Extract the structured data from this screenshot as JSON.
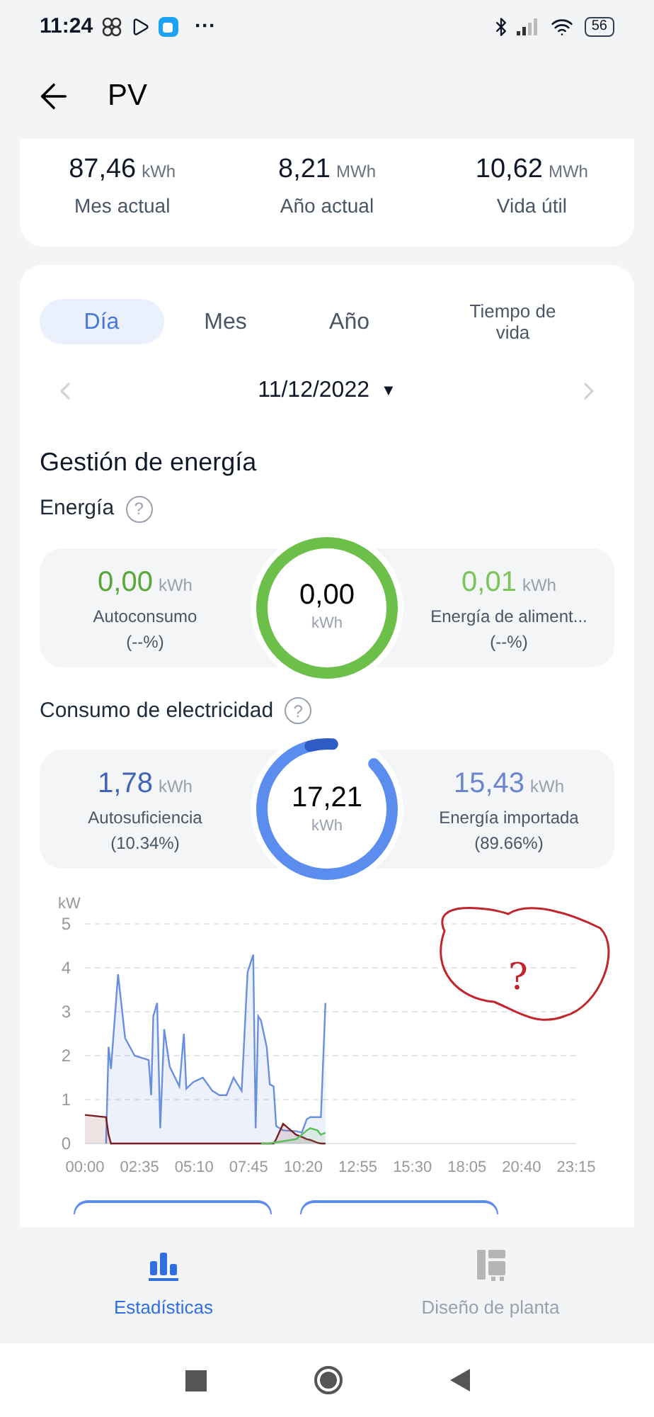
{
  "status_bar": {
    "time": "11:24",
    "more": "···",
    "battery": "56"
  },
  "header": {
    "title": "PV"
  },
  "totals": [
    {
      "value": "87,46",
      "unit": "kWh",
      "label": "Mes actual"
    },
    {
      "value": "8,21",
      "unit": "MWh",
      "label": "Año actual"
    },
    {
      "value": "10,62",
      "unit": "MWh",
      "label": "Vida útil"
    }
  ],
  "tabs": [
    {
      "label": "Día",
      "selected": true
    },
    {
      "label": "Mes",
      "selected": false
    },
    {
      "label": "Año",
      "selected": false
    },
    {
      "label": "Tiempo de vida",
      "selected": false
    }
  ],
  "date": "11/12/2022",
  "date_caret": "▼",
  "section_title": "Gestión de energía",
  "energy": {
    "title": "Energía",
    "help": "?",
    "left": {
      "value": "0,00",
      "unit": "kWh",
      "label": "Autoconsumo",
      "share": "(--%)"
    },
    "center": {
      "value": "0,00",
      "unit": "kWh"
    },
    "right": {
      "value": "0,01",
      "unit": "kWh",
      "label": "Energía de aliment...",
      "share": "(--%)"
    }
  },
  "consumption": {
    "title": "Consumo de electricidad",
    "help": "?",
    "level": 0.1034,
    "left": {
      "value": "1,78",
      "unit": "kWh",
      "label": "Autosuficiencia",
      "share": "(10.34%)"
    },
    "center": {
      "value": "17,21",
      "unit": "kWh"
    },
    "right": {
      "value": "15,43",
      "unit": "kWh",
      "label": "Energía importada",
      "share": "(89.66%)"
    }
  },
  "chart": {
    "scribble": {
      "text": "?"
    },
    "chart_data": {
      "type": "area",
      "grid": true,
      "ylabel": "kW",
      "ylim": [
        0,
        5
      ],
      "xlim": [
        0,
        1395
      ],
      "yticks": [
        0,
        1,
        2,
        3,
        4,
        5
      ],
      "xticks": [
        {
          "value": 0,
          "label": "00:00"
        },
        {
          "value": 155,
          "label": "02:35"
        },
        {
          "value": 310,
          "label": "05:10"
        },
        {
          "value": 465,
          "label": "07:45"
        },
        {
          "value": 620,
          "label": "10:20"
        },
        {
          "value": 775,
          "label": "12:55"
        },
        {
          "value": 930,
          "label": "15:30"
        },
        {
          "value": 1085,
          "label": "18:05"
        },
        {
          "value": 1240,
          "label": "20:40"
        },
        {
          "value": 1395,
          "label": "23:15"
        }
      ],
      "x": [
        0,
        60,
        67,
        74,
        94,
        114,
        141,
        181,
        188,
        194,
        205,
        214,
        225,
        241,
        268,
        281,
        288,
        308,
        335,
        362,
        382,
        402,
        422,
        445,
        462,
        478,
        485,
        492,
        500,
        516,
        525,
        536,
        543,
        563,
        600,
        616,
        630,
        640,
        660,
        670,
        683
      ],
      "series": [
        {
          "color": "#6a8fde",
          "values": [
            null,
            0,
            2.2,
            1.7,
            3.85,
            2.4,
            2.0,
            1.9,
            1.1,
            2.9,
            3.2,
            0.35,
            2.6,
            1.75,
            1.3,
            2.5,
            1.25,
            1.4,
            1.5,
            1.2,
            1.1,
            1.1,
            1.5,
            1.2,
            3.9,
            4.3,
            0.35,
            2.9,
            2.8,
            2.2,
            1.35,
            1.3,
            0.4,
            0.3,
            0.28,
            0.25,
            0.55,
            0.6,
            0.6,
            0.6,
            3.2
          ]
        },
        {
          "color": "#7a1f1f",
          "values": [
            0.65,
            0.6,
            0.2,
            0,
            0,
            0,
            0,
            0,
            0,
            0,
            0,
            0,
            0,
            0,
            0,
            0,
            0,
            0,
            0,
            0,
            0,
            0,
            0,
            0,
            0,
            0,
            0,
            0,
            0,
            0,
            0,
            0,
            0.1,
            0.45,
            0.2,
            0.15,
            0.1,
            0.08,
            0.02,
            0,
            0
          ]
        },
        {
          "color": "#5cbf5c",
          "values": [
            null,
            null,
            null,
            null,
            null,
            null,
            null,
            null,
            null,
            null,
            null,
            null,
            null,
            null,
            null,
            null,
            null,
            null,
            null,
            null,
            null,
            null,
            null,
            null,
            null,
            null,
            null,
            null,
            0,
            0,
            0,
            0.02,
            0.03,
            0.05,
            0.1,
            0.2,
            0.3,
            0.35,
            0.3,
            0.2,
            0.25
          ]
        }
      ]
    }
  },
  "nav": [
    {
      "label": "Estadísticas",
      "selected": true,
      "kind": "stats"
    },
    {
      "label": "Diseño de planta",
      "selected": false,
      "kind": "layout"
    }
  ]
}
